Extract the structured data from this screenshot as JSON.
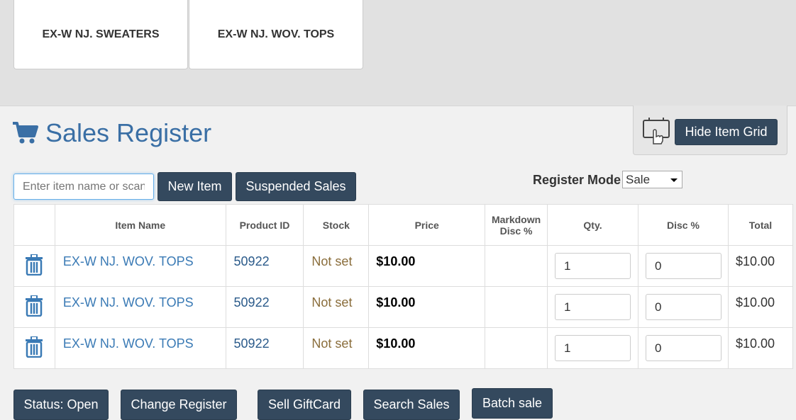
{
  "tiles": [
    "EX-W NJ. SWEATERS",
    "EX-W NJ. WOV. TOPS"
  ],
  "title": "Sales Register",
  "hide_grid_label": "Hide Item Grid",
  "search": {
    "placeholder": "Enter item name or scan barcode"
  },
  "toolbar": {
    "new_item": "New Item",
    "suspended_sales": "Suspended Sales"
  },
  "register_mode": {
    "label": "Register Mode",
    "value": "Sale"
  },
  "table": {
    "headers": [
      "Item Name",
      "Product ID",
      "Stock",
      "Price",
      "Markdown Disc %",
      "Qty.",
      "Disc %",
      "Total"
    ],
    "rows": [
      {
        "name": "EX-W NJ. WOV. TOPS",
        "pid": "50922",
        "stock": "Not set",
        "price": "$10.00",
        "markdown": "",
        "qty": "1",
        "disc": "0",
        "total": "$10.00"
      },
      {
        "name": "EX-W NJ. WOV. TOPS",
        "pid": "50922",
        "stock": "Not set",
        "price": "$10.00",
        "markdown": "",
        "qty": "1",
        "disc": "0",
        "total": "$10.00"
      },
      {
        "name": "EX-W NJ. WOV. TOPS",
        "pid": "50922",
        "stock": "Not set",
        "price": "$10.00",
        "markdown": "",
        "qty": "1",
        "disc": "0",
        "total": "$10.00"
      }
    ]
  },
  "footer": {
    "status": "Status: Open",
    "change_register": "Change Register",
    "sell_giftcard": "Sell GiftCard",
    "search_sales": "Search Sales",
    "batch_sale": "Batch sale"
  },
  "icons": {
    "cart": "shopping-cart-icon",
    "grid": "touch-screen-icon",
    "delete": "trash-icon"
  },
  "colors": {
    "accent": "#3a6fa5",
    "button": "#34495e"
  }
}
